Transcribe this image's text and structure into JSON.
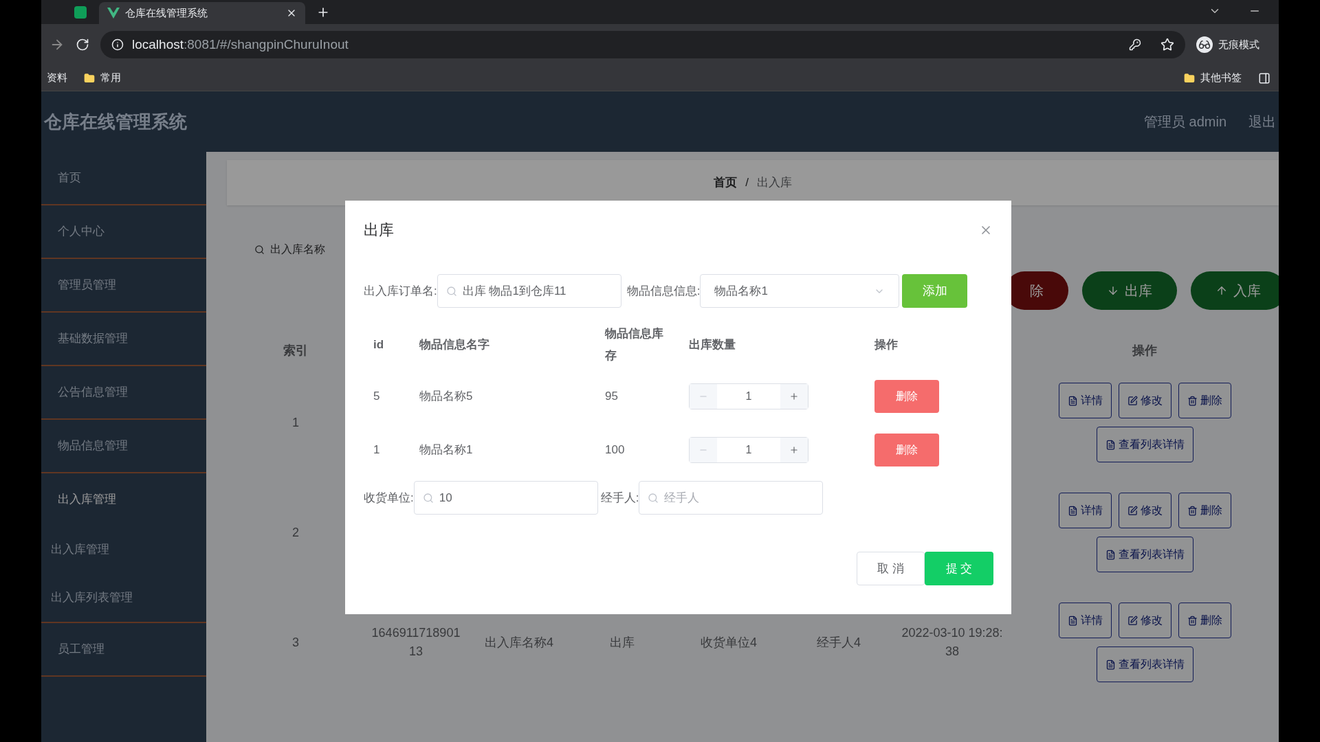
{
  "browser": {
    "tab_title": "仓库在线管理系统",
    "url_host": "localhost",
    "url_path": ":8081/#/shangpinChuruInout",
    "profile": "无痕模式",
    "bookmarks": [
      "资料",
      "常用"
    ],
    "other_bookmarks": "其他书签"
  },
  "header": {
    "title": "仓库在线管理系统",
    "user": "管理员 admin",
    "logout": "退出"
  },
  "sidebar": {
    "items": [
      {
        "label": "首页",
        "expanded": false
      },
      {
        "label": "个人中心",
        "expanded": false
      },
      {
        "label": "管理员管理",
        "expanded": false
      },
      {
        "label": "基础数据管理",
        "expanded": false
      },
      {
        "label": "公告信息管理",
        "expanded": false
      },
      {
        "label": "物品信息管理",
        "expanded": false
      },
      {
        "label": "出入库管理",
        "expanded": true,
        "children": [
          {
            "label": "出入库管理"
          },
          {
            "label": "出入库列表管理"
          }
        ]
      },
      {
        "label": "员工管理",
        "expanded": false
      }
    ]
  },
  "breadcrumb": {
    "items": [
      "首页",
      "出入库"
    ],
    "separator": "/"
  },
  "search": {
    "placeholder": "出入库名称"
  },
  "toolbar": [
    {
      "label": "除",
      "kind": "danger"
    },
    {
      "label": "出库",
      "kind": "out"
    },
    {
      "label": "入库",
      "kind": "in"
    }
  ],
  "table": {
    "columns": [
      "索引",
      "",
      "",
      "",
      "",
      "",
      "",
      "操作"
    ],
    "rows": [
      {
        "index": "1",
        "cells": [],
        "actions": [
          "详情",
          "修改",
          "删除",
          "查看列表详情"
        ]
      },
      {
        "index": "2",
        "cells": [],
        "actions": [
          "详情",
          "修改",
          "删除",
          "查看列表详情"
        ]
      },
      {
        "index": "3",
        "cells": [
          "164691171890113",
          "出入库名称4",
          "出库",
          "收货单位4",
          "经手人4",
          "2022-03-10 19:28:38"
        ],
        "actions": [
          "详情",
          "修改",
          "删除",
          "查看列表详情"
        ]
      }
    ]
  },
  "dialog": {
    "title": "出库",
    "order_label": "出入库订单名:",
    "order_value": "出库 物品1到仓库11",
    "item_label": "物品信息信息:",
    "item_value": "物品名称1",
    "add_button": "添加",
    "columns": [
      "id",
      "物品信息名字",
      "物品信息库存",
      "出库数量",
      "操作"
    ],
    "rows": [
      {
        "id": "5",
        "name": "物品名称5",
        "stock": "95",
        "quantity": "1",
        "action": "删除"
      },
      {
        "id": "1",
        "name": "物品名称1",
        "stock": "100",
        "quantity": "1",
        "action": "删除"
      }
    ],
    "receiver_label": "收货单位:",
    "receiver_value": "10",
    "handler_label": "经手人:",
    "handler_placeholder": "经手人",
    "cancel": "取 消",
    "submit": "提 交"
  }
}
